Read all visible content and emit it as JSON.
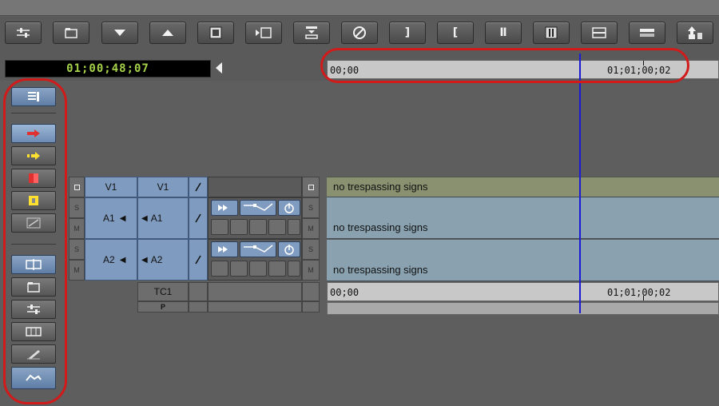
{
  "toolbar": {
    "buttons": [
      {
        "name": "settings-sliders-icon",
        "label": ""
      },
      {
        "name": "bin-icon",
        "label": ""
      },
      {
        "name": "down-arrow-icon",
        "label": ""
      },
      {
        "name": "up-arrow-icon",
        "label": ""
      },
      {
        "name": "effect-icon",
        "label": ""
      },
      {
        "name": "insert-icon",
        "label": ""
      },
      {
        "name": "overwrite-icon",
        "label": ""
      },
      {
        "name": "no-entry-icon",
        "label": "⊘"
      },
      {
        "name": "mark-out-icon",
        "label": "]"
      },
      {
        "name": "mark-in-icon",
        "label": "["
      },
      {
        "name": "mark-clip-icon",
        "label": "Ⅱ"
      },
      {
        "name": "mark-clip-alt-icon",
        "label": ""
      },
      {
        "name": "lift-icon",
        "label": ""
      },
      {
        "name": "extract-icon",
        "label": ""
      },
      {
        "name": "export-icon",
        "label": ""
      }
    ]
  },
  "timecode": {
    "master": "01;00;48;07"
  },
  "ruler": {
    "start": "00;00",
    "mark": "01;01;00;02"
  },
  "tracks": {
    "video": {
      "record": "V1",
      "source": "V1"
    },
    "audio1": {
      "record": "A1",
      "source": "A1"
    },
    "audio2": {
      "record": "A2",
      "source": "A2"
    },
    "tc": "TC1",
    "p": "P",
    "s_label": "S",
    "m_label": "M"
  },
  "clips": {
    "v1": "no trespassing signs",
    "a1": "no trespassing signs",
    "a2": "no trespassing signs"
  },
  "tc_ruler": {
    "start": "00;00",
    "mark": "01;01;00;02"
  },
  "colors": {
    "callout": "#d11a1a",
    "playhead": "#1b1bd6",
    "video_clip": "#8a9171",
    "audio_clip": "#8aa2b0",
    "track_blue": "#7f9bbf",
    "timecode_green": "#a6d24a"
  }
}
